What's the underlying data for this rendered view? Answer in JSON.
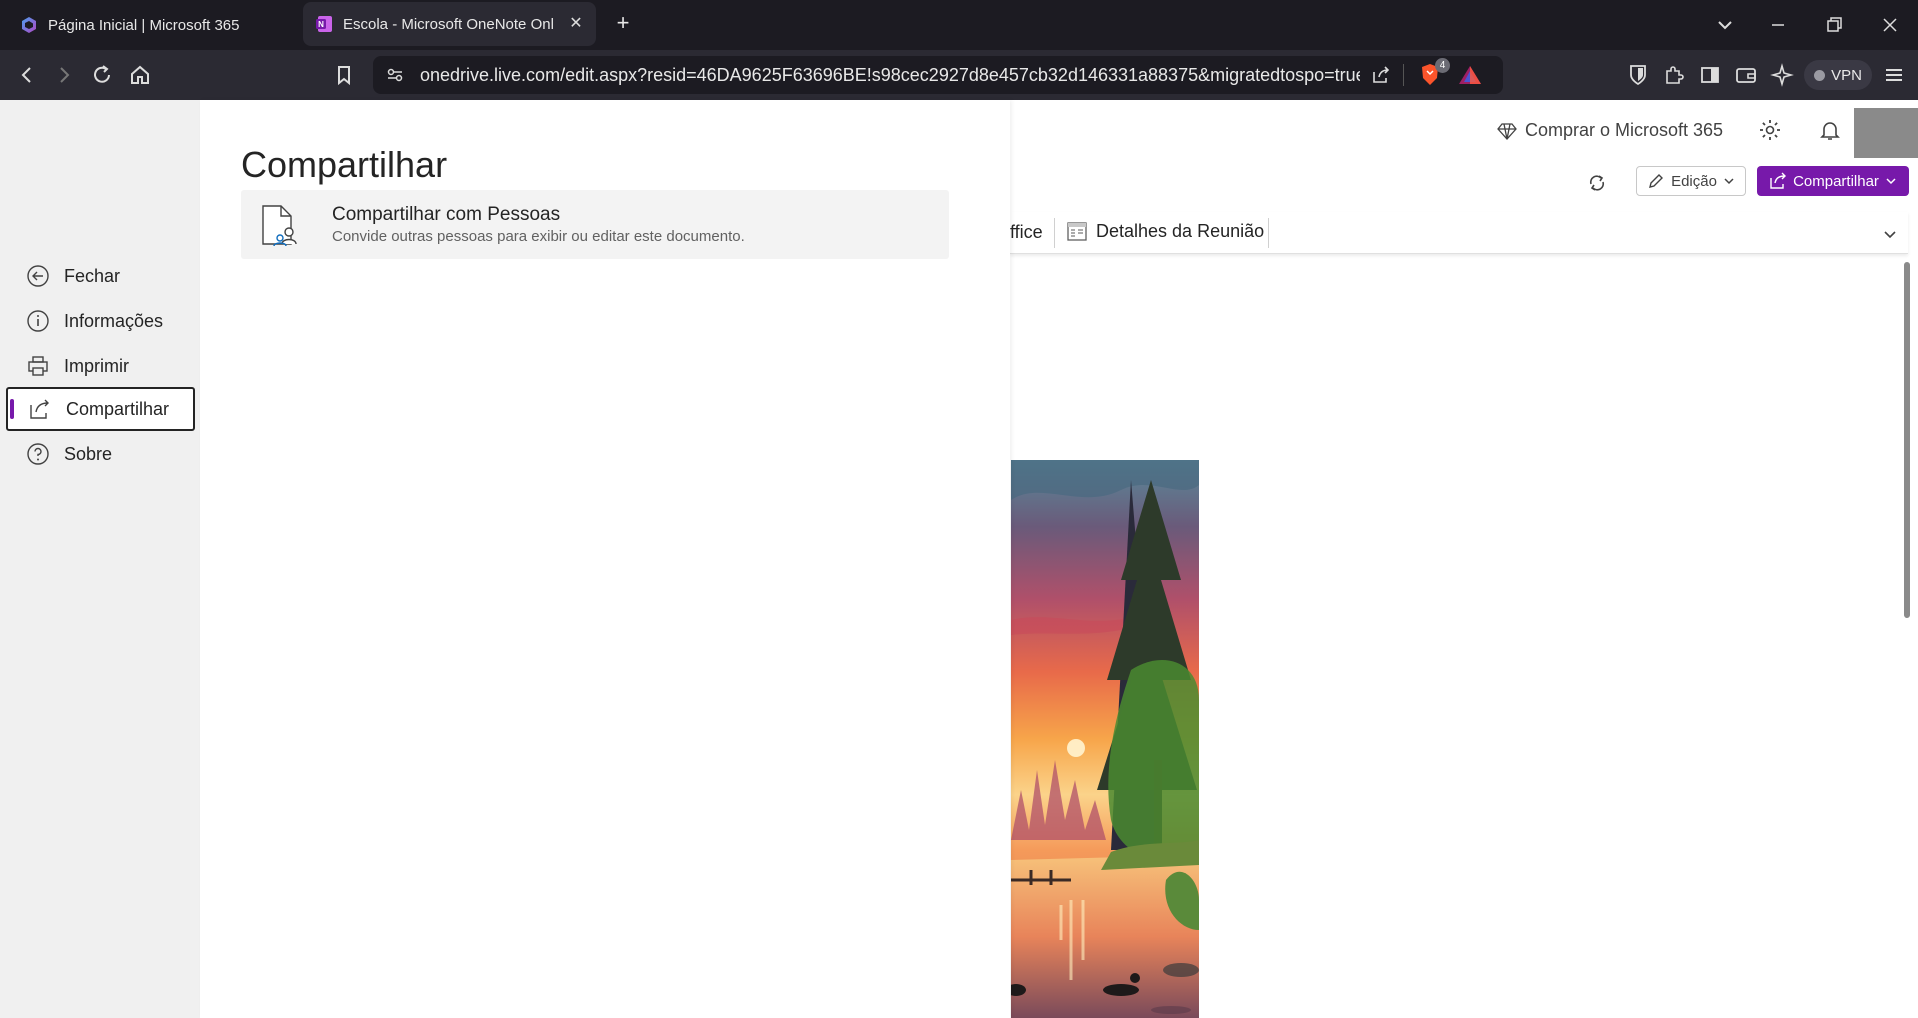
{
  "browser": {
    "tabs": [
      {
        "label": "Página Inicial | Microsoft 365",
        "active": false
      },
      {
        "label": "Escola - Microsoft OneNote Online",
        "active": true
      }
    ],
    "url": "onedrive.live.com/edit.aspx?resid=46DA9625F63696BE!s98cec2927d8e457cb32d146331a88375&migratedtospo=true&...",
    "shields_count": "4",
    "vpn_label": "VPN"
  },
  "header": {
    "buy_label": "Comprar o Microsoft 365",
    "edit_mode_label": "Edição",
    "share_label": "Compartilhar"
  },
  "ribbon": {
    "office_label": "ffice",
    "meeting_details_label": "Detalhes da Reunião"
  },
  "backstage": {
    "nav": [
      {
        "label": "Fechar",
        "icon": "back-arrow-icon"
      },
      {
        "label": "Informações",
        "icon": "info-icon"
      },
      {
        "label": "Imprimir",
        "icon": "printer-icon"
      },
      {
        "label": "Compartilhar",
        "icon": "share-icon",
        "active": true
      },
      {
        "label": "Sobre",
        "icon": "help-icon"
      }
    ],
    "title": "Compartilhar",
    "option": {
      "title": "Compartilhar com Pessoas",
      "description": "Convide outras pessoas para exibir ou editar este documento."
    }
  },
  "colors": {
    "accent": "#7719aa",
    "chrome_dark": "#1c1b22",
    "chrome_mid": "#2b2a33"
  }
}
